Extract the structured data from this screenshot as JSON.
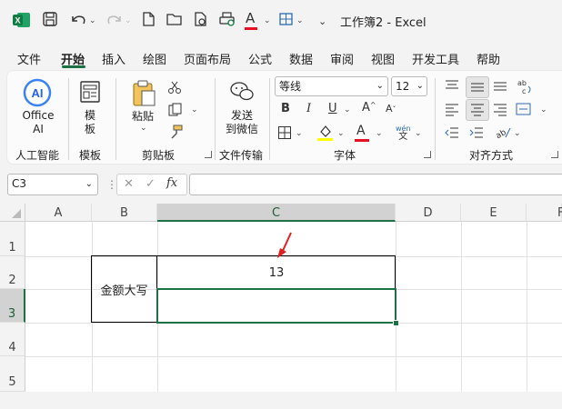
{
  "titlebar": {
    "title": "工作簿2 - Excel",
    "font_color_accent": "#e81123",
    "brand_color": "#1e7145"
  },
  "tabs": [
    {
      "label": "文件"
    },
    {
      "label": "开始",
      "active": true
    },
    {
      "label": "插入"
    },
    {
      "label": "绘图"
    },
    {
      "label": "页面布局"
    },
    {
      "label": "公式"
    },
    {
      "label": "数据"
    },
    {
      "label": "审阅"
    },
    {
      "label": "视图"
    },
    {
      "label": "开发工具"
    },
    {
      "label": "帮助"
    }
  ],
  "ribbon": {
    "office_ai_line1": "Office",
    "office_ai_line2": "AI",
    "ai_badge": "AI",
    "template_line1": "模",
    "template_line2": "板",
    "paste_label": "粘贴",
    "send_line1": "发送",
    "send_line2": "到微信",
    "font_name": "等线",
    "font_size": "12",
    "bold": "B",
    "italic": "I",
    "underline": "U",
    "font_color_letter": "A",
    "highlight_color": "#ffff00",
    "font_color": "#e81123",
    "wen_top": "wén",
    "wen_bottom": "文",
    "groups": {
      "ai": "人工智能",
      "template": "模板",
      "clipboard": "剪贴板",
      "transfer": "文件传输",
      "font": "字体",
      "align": "对齐方式"
    }
  },
  "formula_bar": {
    "name_box": "C3",
    "fx": "fx",
    "value": ""
  },
  "sheet": {
    "columns": [
      "A",
      "B",
      "C",
      "D",
      "E",
      "F"
    ],
    "rows": [
      "1",
      "2",
      "3",
      "4",
      "5"
    ],
    "selected_column": "C",
    "selected_row": "3",
    "cells": {
      "B2": "金额大写",
      "C2": "13"
    },
    "annotation_arrow_color": "#e02020"
  }
}
